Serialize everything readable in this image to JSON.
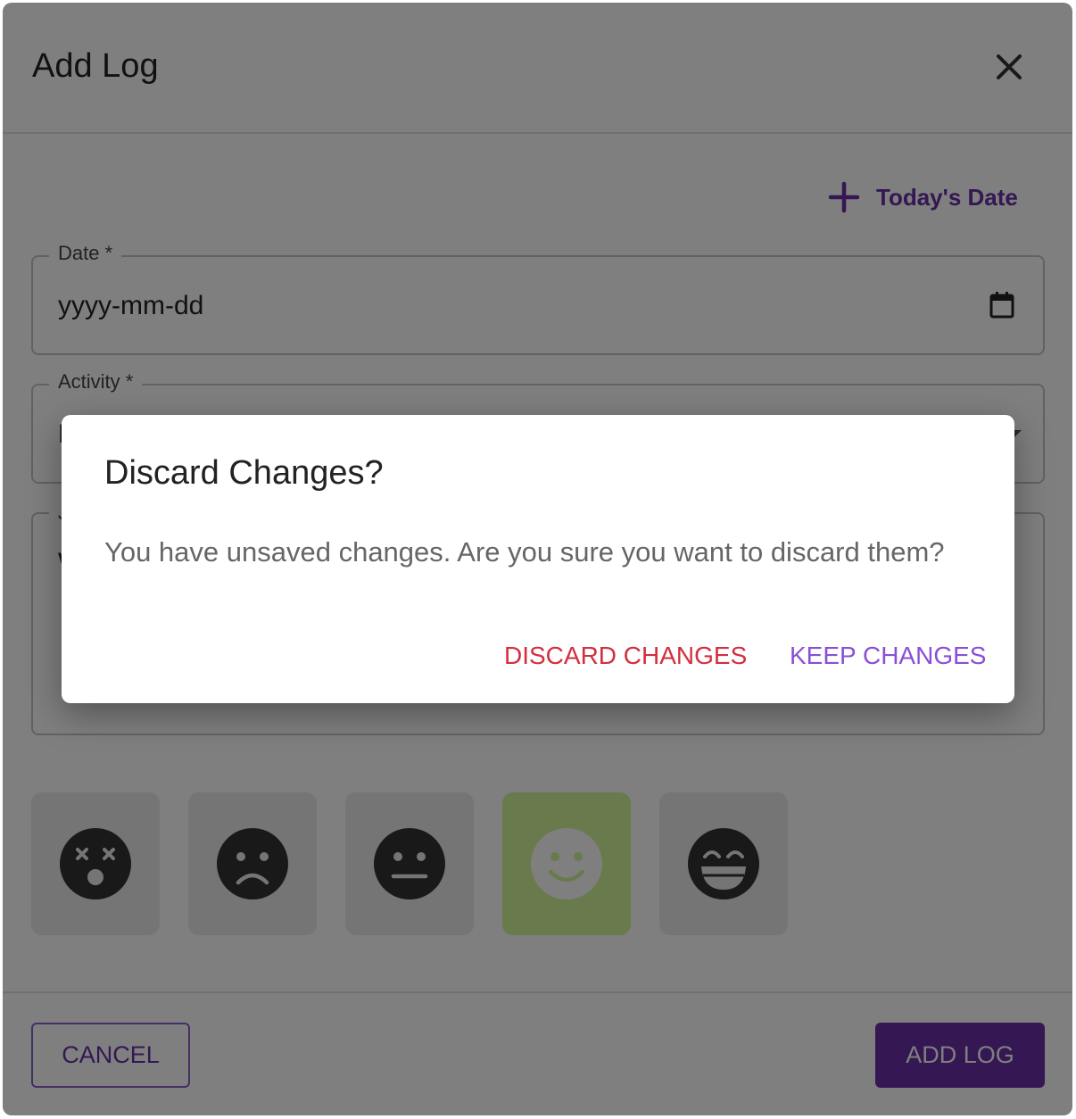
{
  "modal": {
    "title": "Add Log",
    "today_button": "Today's Date",
    "date_field": {
      "label": "Date *",
      "value": "yyyy-mm-dd"
    },
    "activity_field": {
      "label": "Activity *",
      "value_visible": "E"
    },
    "notes_field": {
      "label_visible": "J",
      "value_visible": "W"
    },
    "moods": [
      {
        "icon": "dizzy-face-icon",
        "selected": false
      },
      {
        "icon": "frown-face-icon",
        "selected": false
      },
      {
        "icon": "neutral-face-icon",
        "selected": false
      },
      {
        "icon": "smile-face-icon",
        "selected": true
      },
      {
        "icon": "grin-face-icon",
        "selected": false
      }
    ],
    "cancel_label": "CANCEL",
    "add_label": "ADD LOG"
  },
  "dialog": {
    "title": "Discard Changes?",
    "message": "You have unsaved changes. Are you sure you want to discard them?",
    "discard_label": "DISCARD CHANGES",
    "keep_label": "KEEP CHANGES"
  },
  "colors": {
    "primary": "#6a2ea6",
    "danger": "#d32f3f",
    "keep": "#8b4fd6",
    "selected_mood": "#d3f59a",
    "overlay": "rgba(0,0,0,0.5)"
  }
}
